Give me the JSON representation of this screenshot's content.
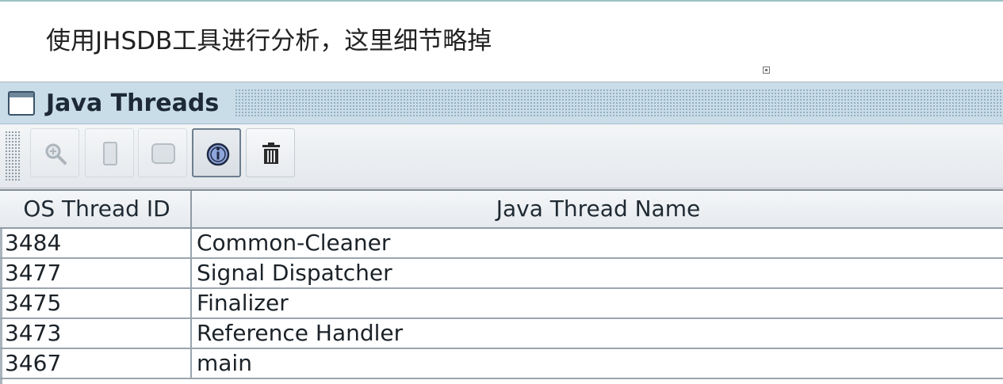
{
  "caption": "使用JHSDB工具进行分析，这里细节略掉",
  "window": {
    "title": "Java Threads",
    "icon": "window-icon"
  },
  "toolbar": {
    "buttons": [
      {
        "name": "inspect-thread-button",
        "icon": "magnifier-plus-icon",
        "enabled": false
      },
      {
        "name": "stack-memory-button",
        "icon": "stack-memory-icon",
        "enabled": false
      },
      {
        "name": "show-stack-trace-button",
        "icon": "stack-trace-icon",
        "enabled": false
      },
      {
        "name": "thread-info-button",
        "icon": "info-icon",
        "enabled": true,
        "selected": true
      },
      {
        "name": "delete-button",
        "icon": "trash-icon",
        "enabled": true
      }
    ]
  },
  "table": {
    "columns": [
      "OS Thread ID",
      "Java Thread Name"
    ],
    "rows": [
      {
        "id": "3484",
        "name": "Common-Cleaner"
      },
      {
        "id": "3477",
        "name": "Signal Dispatcher"
      },
      {
        "id": "3475",
        "name": "Finalizer"
      },
      {
        "id": "3473",
        "name": "Reference Handler"
      },
      {
        "id": "3467",
        "name": "main"
      }
    ]
  }
}
